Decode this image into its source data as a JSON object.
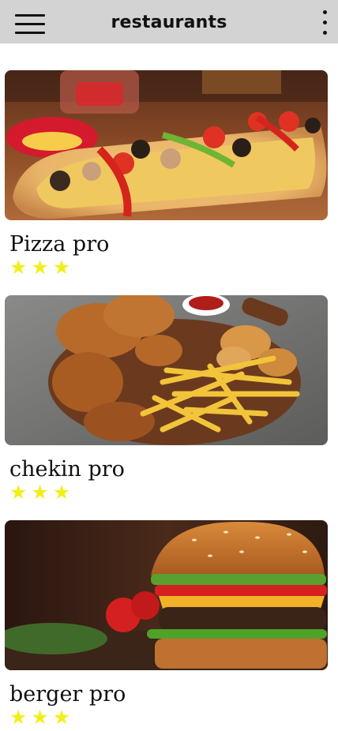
{
  "appbar": {
    "title": "restaurants",
    "menu_icon": "hamburger-menu-icon",
    "more_icon": "more-vert-icon",
    "background": "#d3d3d3"
  },
  "restaurants": [
    {
      "name": "Pizza pro",
      "rating": 3,
      "image": "pizza-photo"
    },
    {
      "name": "chekin pro",
      "rating": 3,
      "image": "fried-chicken-photo"
    },
    {
      "name": "berger pro",
      "rating": 3,
      "image": "burger-photo"
    }
  ],
  "star_glyph": "★",
  "star_color": "#f2ee1a"
}
